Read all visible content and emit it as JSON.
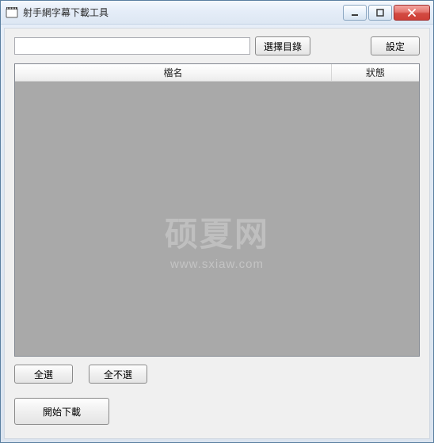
{
  "window": {
    "title": "射手網字幕下載工具"
  },
  "toolbar": {
    "path_value": "",
    "browse_label": "選擇目錄",
    "settings_label": "設定"
  },
  "list": {
    "col_name": "檔名",
    "col_status": "狀態",
    "rows": []
  },
  "buttons": {
    "select_all": "全選",
    "select_none": "全不選",
    "start": "開始下載"
  },
  "watermark": {
    "text": "硕夏网",
    "url": "www.sxiaw.com"
  }
}
